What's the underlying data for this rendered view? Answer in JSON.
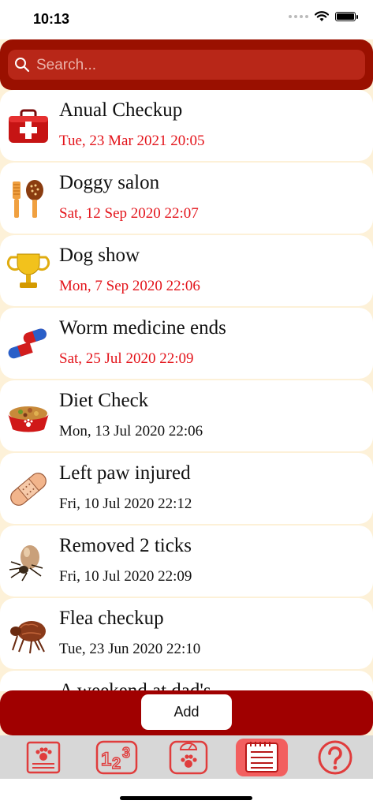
{
  "status": {
    "time": "10:13"
  },
  "search": {
    "placeholder": "Search..."
  },
  "events": [
    {
      "title": "Anual Checkup",
      "date": "Tue, 23 Mar 2021 20:05",
      "upcoming": true,
      "icon": "medical-kit-icon"
    },
    {
      "title": "Doggy salon",
      "date": "Sat, 12 Sep 2020 22:07",
      "upcoming": true,
      "icon": "comb-brush-icon"
    },
    {
      "title": "Dog show",
      "date": "Mon, 7 Sep 2020 22:06",
      "upcoming": true,
      "icon": "trophy-icon"
    },
    {
      "title": "Worm medicine ends",
      "date": "Sat, 25 Jul 2020 22:09",
      "upcoming": true,
      "icon": "pills-icon"
    },
    {
      "title": "Diet Check",
      "date": "Mon, 13 Jul 2020 22:06",
      "upcoming": false,
      "icon": "food-bowl-icon"
    },
    {
      "title": "Left paw injured",
      "date": "Fri, 10 Jul 2020 22:12",
      "upcoming": false,
      "icon": "bandage-icon"
    },
    {
      "title": "Removed 2 ticks",
      "date": "Fri, 10 Jul 2020 22:09",
      "upcoming": false,
      "icon": "tick-insect-icon"
    },
    {
      "title": "Flea checkup",
      "date": "Tue, 23 Jun 2020 22:10",
      "upcoming": false,
      "icon": "flea-icon"
    },
    {
      "title": "A weekend at dad's",
      "date": "",
      "upcoming": false,
      "icon": "calendar-icon"
    }
  ],
  "actions": {
    "add_label": "Add"
  },
  "tabs": [
    {
      "icon": "pet-profile-icon",
      "active": false
    },
    {
      "icon": "numbers-icon",
      "active": false
    },
    {
      "icon": "scale-weight-icon",
      "active": false
    },
    {
      "icon": "notepad-events-icon",
      "active": true
    },
    {
      "icon": "help-icon",
      "active": false
    }
  ],
  "colors": {
    "header": "#9a1000",
    "accent_red": "#e3141b",
    "tab_active": "#f25f5f",
    "icon_red": "#e03c3c"
  }
}
